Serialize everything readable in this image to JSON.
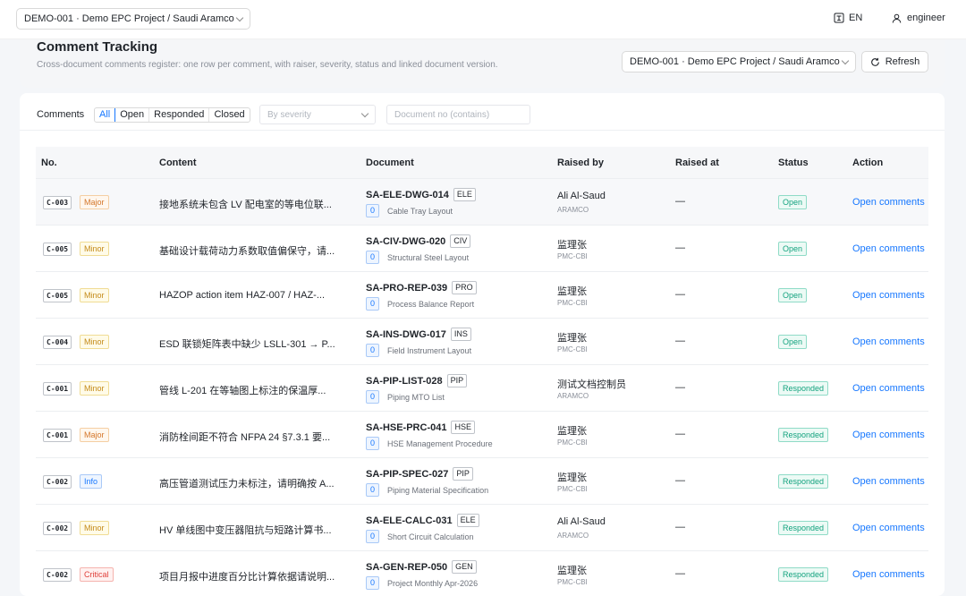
{
  "topbar": {
    "project_select": "DEMO-001 · Demo EPC Project / Saudi Aramco ...",
    "language": "EN",
    "user": "engineer"
  },
  "header": {
    "title": "Comment Tracking",
    "subtitle": "Cross-document comments register: one row per comment, with raiser, severity, status and linked document version.",
    "project_select": "DEMO-001 · Demo EPC Project / Saudi Aramco ...",
    "refresh_label": "Refresh"
  },
  "filters": {
    "label": "Comments",
    "status_options": [
      "All",
      "Open",
      "Responded",
      "Closed"
    ],
    "active_status": "All",
    "severity_placeholder": "By severity",
    "doc_placeholder": "Document no (contains)"
  },
  "table": {
    "columns": [
      "No.",
      "Content",
      "Document",
      "Raised by",
      "Raised at",
      "Status",
      "Action"
    ],
    "rows": [
      {
        "id": "C-003",
        "severity": "Major",
        "content": "接地系统未包含 LV 配电室的等电位联...",
        "doc_no": "SA-ELE-DWG-014",
        "discipline": "ELE",
        "version": "0",
        "doc_title": "Cable Tray Layout",
        "raiser": "Ali Al-Saud",
        "org": "ARAMCO",
        "raised_at": "—",
        "status": "Open",
        "action": "Open comments"
      },
      {
        "id": "C-005",
        "severity": "Minor",
        "content": "基础设计载荷动力系数取值偏保守，请...",
        "doc_no": "SA-CIV-DWG-020",
        "discipline": "CIV",
        "version": "0",
        "doc_title": "Structural Steel Layout",
        "raiser": "监理张",
        "org": "PMC-CBI",
        "raised_at": "—",
        "status": "Open",
        "action": "Open comments"
      },
      {
        "id": "C-005",
        "severity": "Minor",
        "content": "HAZOP action item HAZ-007 / HAZ-...",
        "doc_no": "SA-PRO-REP-039",
        "discipline": "PRO",
        "version": "0",
        "doc_title": "Process Balance Report",
        "raiser": "监理张",
        "org": "PMC-CBI",
        "raised_at": "—",
        "status": "Open",
        "action": "Open comments"
      },
      {
        "id": "C-004",
        "severity": "Minor",
        "content": "ESD 联锁矩阵表中缺少 LSLL-301 → P...",
        "doc_no": "SA-INS-DWG-017",
        "discipline": "INS",
        "version": "0",
        "doc_title": "Field Instrument Layout",
        "raiser": "监理张",
        "org": "PMC-CBI",
        "raised_at": "—",
        "status": "Open",
        "action": "Open comments"
      },
      {
        "id": "C-001",
        "severity": "Minor",
        "content": "管线 L-201 在等轴图上标注的保温厚...",
        "doc_no": "SA-PIP-LIST-028",
        "discipline": "PIP",
        "version": "0",
        "doc_title": "Piping MTO List",
        "raiser": "测试文档控制员",
        "org": "ARAMCO",
        "raised_at": "—",
        "status": "Responded",
        "action": "Open comments"
      },
      {
        "id": "C-001",
        "severity": "Major",
        "content": "消防栓间距不符合 NFPA 24 §7.3.1 要...",
        "doc_no": "SA-HSE-PRC-041",
        "discipline": "HSE",
        "version": "0",
        "doc_title": "HSE Management Procedure",
        "raiser": "监理张",
        "org": "PMC-CBI",
        "raised_at": "—",
        "status": "Responded",
        "action": "Open comments"
      },
      {
        "id": "C-002",
        "severity": "Info",
        "content": "高压管道测试压力未标注，请明确按 A...",
        "doc_no": "SA-PIP-SPEC-027",
        "discipline": "PIP",
        "version": "0",
        "doc_title": "Piping Material Specification",
        "raiser": "监理张",
        "org": "PMC-CBI",
        "raised_at": "—",
        "status": "Responded",
        "action": "Open comments"
      },
      {
        "id": "C-002",
        "severity": "Minor",
        "content": "HV 单线图中变压器阻抗与短路计算书...",
        "doc_no": "SA-ELE-CALC-031",
        "discipline": "ELE",
        "version": "0",
        "doc_title": "Short Circuit Calculation",
        "raiser": "Ali Al-Saud",
        "org": "ARAMCO",
        "raised_at": "—",
        "status": "Responded",
        "action": "Open comments"
      },
      {
        "id": "C-002",
        "severity": "Critical",
        "content": "项目月报中进度百分比计算依据请说明...",
        "doc_no": "SA-GEN-REP-050",
        "discipline": "GEN",
        "version": "0",
        "doc_title": "Project Monthly Apr-2026",
        "raiser": "监理张",
        "org": "PMC-CBI",
        "raised_at": "—",
        "status": "Responded",
        "action": "Open comments"
      }
    ]
  }
}
